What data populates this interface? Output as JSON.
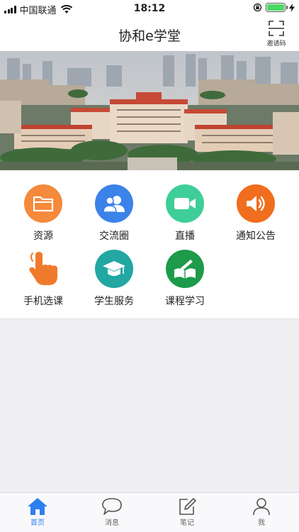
{
  "status_bar": {
    "carrier": "中国联通",
    "time": "18:12"
  },
  "header": {
    "title": "协和e学堂",
    "scan_label": "邀请码",
    "scan_icon": "scan-qr-icon"
  },
  "banner": {
    "icon": "campus-photo",
    "sky_color": "#c9cdd4",
    "roof_color": "#c64a36",
    "wall_color": "#e8d9c8",
    "tree_color": "#3f6b3a"
  },
  "features": [
    {
      "label": "资源",
      "icon": "folder-icon",
      "color": "#f5893c"
    },
    {
      "label": "交流圈",
      "icon": "users-icon",
      "color": "#3b82e9"
    },
    {
      "label": "直播",
      "icon": "video-camera-icon",
      "color": "#3fce99"
    },
    {
      "label": "通知公告",
      "icon": "speaker-icon",
      "color": "#f06e1d"
    },
    {
      "label": "手机选课",
      "icon": "tap-hand-icon",
      "color": "#f07a2c"
    },
    {
      "label": "学生服务",
      "icon": "graduation-cap-icon",
      "color": "#22a7a2"
    },
    {
      "label": "课程学习",
      "icon": "book-pen-icon",
      "color": "#1d9a4a"
    }
  ],
  "tabbar": {
    "active_color": "#2d7ff0",
    "items": [
      {
        "label": "首页",
        "icon": "home-icon"
      },
      {
        "label": "消息",
        "icon": "chat-bubble-icon"
      },
      {
        "label": "笔记",
        "icon": "note-edit-icon"
      },
      {
        "label": "我",
        "icon": "person-icon"
      }
    ]
  }
}
